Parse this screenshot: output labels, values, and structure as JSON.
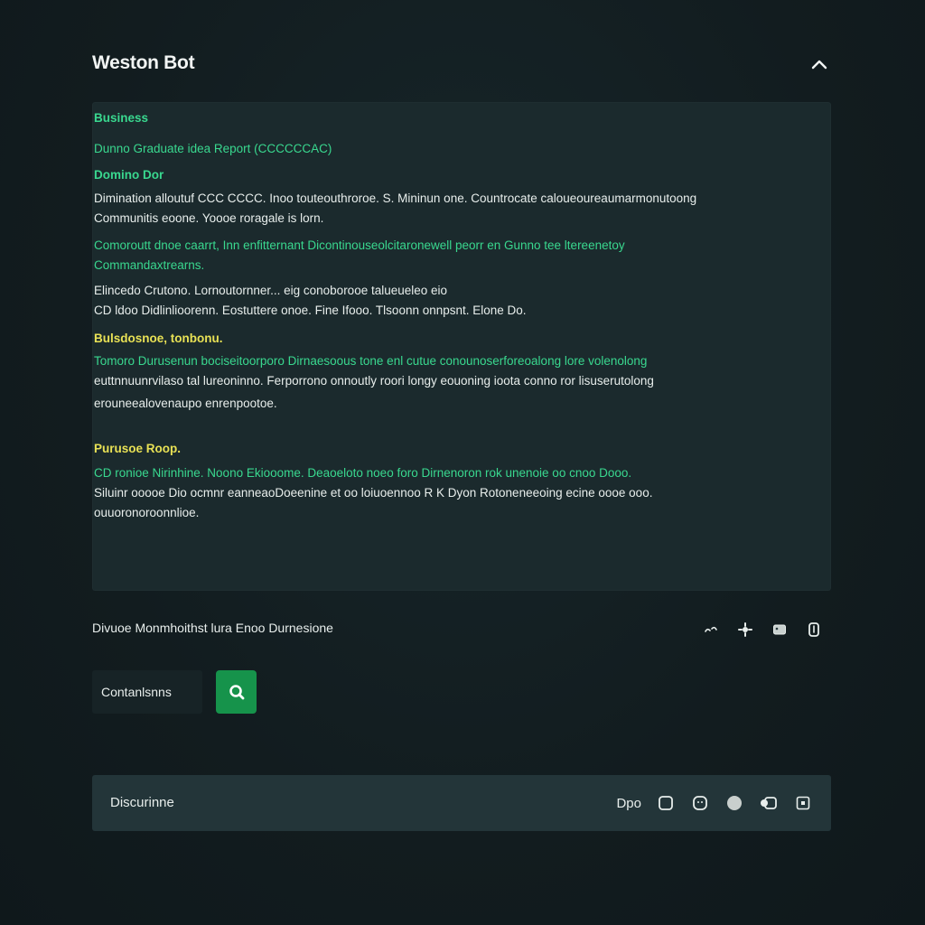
{
  "app": {
    "title": "Weston Bot"
  },
  "output": {
    "blocks": [
      {
        "kind": "heading-green",
        "lines": [
          "Business"
        ]
      },
      {
        "kind": "text-green",
        "lines": [
          "Dunno Graduate idea Report (CCCCCCAC)"
        ]
      },
      {
        "kind": "heading-green",
        "lines": [
          "Domino Dor"
        ]
      },
      {
        "kind": "text-white",
        "lines": [
          "Dimination alloutuf CCC CCCC. Inoo touteouthroroe. S. Mininun one. Countrocate caloueoureaumarmonutoong",
          "Communitis eoone. Yoooe roragale is lorn."
        ]
      },
      {
        "kind": "text-green",
        "lines": [
          "Comoroutt dnoe caarrt, Inn enfitternant Dicontinouseolcitaronewell peorr en Gunno tee ltereenetoy",
          "Commandaxtrearns."
        ]
      },
      {
        "kind": "text-white",
        "lines": [
          "Elincedo Crutono. Lornoutornner... eig conoborooe talueueleo eio",
          "CD ldoo Didlinlioorenn. Eostuttere onoe. Fine Ifooo. Tlsoonn onnpsnt. Elone Do."
        ]
      },
      {
        "kind": "heading-yellow",
        "lines": [
          "Bulsdosnoe, tonbonu."
        ]
      },
      {
        "kind": "text-mixed",
        "lines": [
          "Tomoro Durusenun bociseitoorporo Dirnaesoous tone enl cutue conounoserforeoalong lore volenolong",
          "euttnnuunrvilaso tal lureoninno. Ferporrono onnoutly roori longy eouoning ioota conno ror lisuserutolong",
          "erouneealovenaupo enrenpootoe."
        ]
      },
      {
        "kind": "heading-yellow",
        "lines": [
          "Purusoe Roop."
        ]
      },
      {
        "kind": "text-mixed2",
        "lines": [
          "CD ronioe Nirinhine. Noono Ekiooome. Deaoeloto noeo foro Dirnenoron rok unenoie oo cnoo Dooo.",
          "Siluinr ooooe Dio ocmnr eanneaoDoeenine et oo loiuoennoo R K Dyon Rotoneneeoing ecine oooe ooo.",
          "ouuoronoroonnlioe."
        ]
      }
    ]
  },
  "toolbar": {
    "label": "Divuoe Monmhoithst lura Enoo Durnesione"
  },
  "search": {
    "placeholder": "Contanlsnns",
    "value": "Contanlsnns"
  },
  "bottom_bar": {
    "label": "Discurinne",
    "action_text": "Dpo"
  },
  "colors": {
    "accent_green": "#39d88f",
    "accent_yellow": "#e8e155",
    "button_green": "#16934b"
  }
}
